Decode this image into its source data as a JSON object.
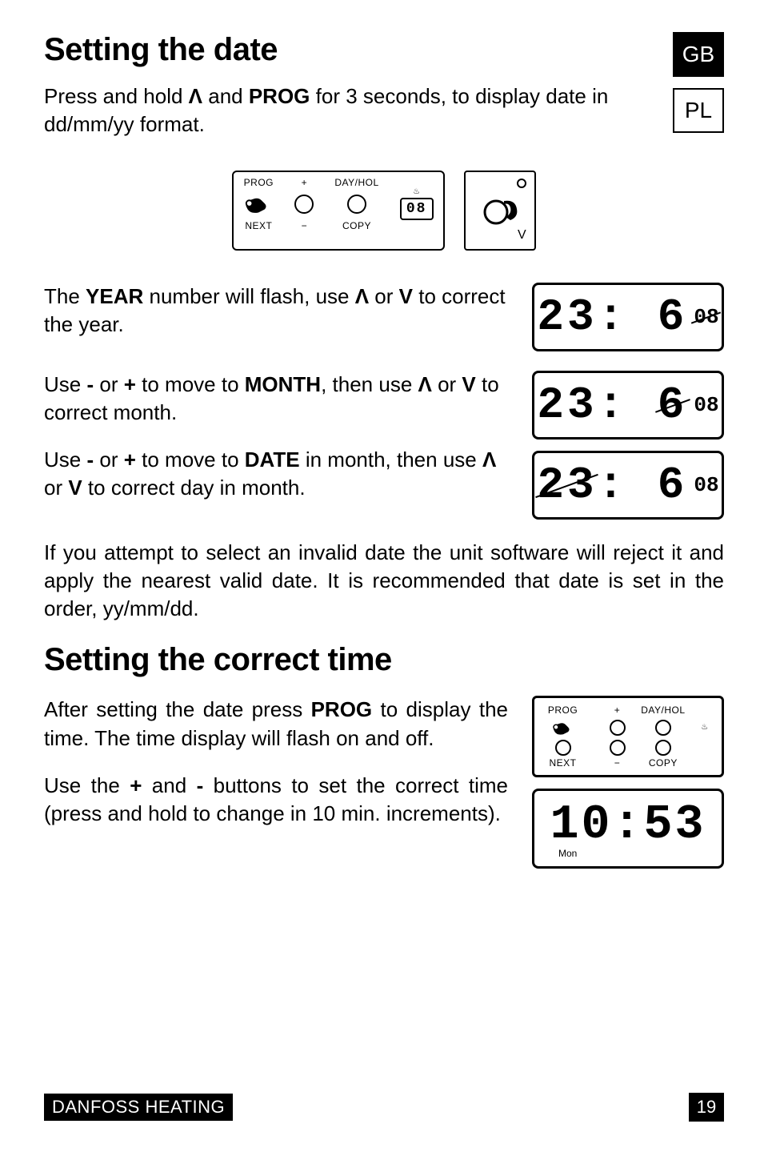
{
  "lang": {
    "gb": "GB",
    "pl": "PL"
  },
  "section1": {
    "title": "Setting the date",
    "intro_pre": "Press and hold ",
    "intro_sym1": "Λ",
    "intro_mid1": " and ",
    "intro_bold1": "PROG",
    "intro_post": " for 3 seconds, to display date in dd/mm/yy format."
  },
  "fig1": {
    "labels": {
      "prog": "PROG",
      "plus": "+",
      "dayhol": "DAY/HOL",
      "next": "NEXT",
      "minus": "−",
      "copy": "COPY"
    },
    "small_digits": "08",
    "flame": "♨",
    "dial_v": "V"
  },
  "step_year": {
    "pre": "The ",
    "b1": "YEAR",
    "mid": " number will flash, use ",
    "s1": "Λ",
    "or": " or ",
    "s2": "V",
    "post": " to correct the year.",
    "lcd_main": "23: 6",
    "lcd_sub": "08"
  },
  "step_month": {
    "pre": "Use ",
    "b_minus": "-",
    "or1": " or ",
    "b_plus": "+",
    "mid1": " to move to ",
    "b_month": "MONTH",
    "mid2": ", then use ",
    "s1": "Λ",
    "or2": " or ",
    "s2": "V",
    "post": " to correct month.",
    "lcd_main": "23: 6",
    "lcd_sub": "08"
  },
  "step_date": {
    "pre": "Use ",
    "b_minus": "-",
    "or1": " or ",
    "b_plus": "+",
    "mid1": " to move to ",
    "b_date": "DATE",
    "mid2": " in month, then use ",
    "s1": "Λ",
    "or2": " or ",
    "s2": "V",
    "post": " to correct day in month.",
    "lcd_main": "23: 6",
    "lcd_sub": "08"
  },
  "note": "If you attempt to select an invalid date the unit software will reject it and apply the nearest valid date. It is recommended that date is set in the order, yy/mm/dd.",
  "section2": {
    "title": "Setting the correct time",
    "p1_pre": "After setting the date press ",
    "p1_b": "PROG",
    "p1_post": " to display the time. The time display will flash on and off.",
    "p2_pre": "Use the ",
    "p2_plus": "+",
    "p2_and": " and ",
    "p2_minus": "-",
    "p2_post": " buttons to set the correct time (press and hold to change in 10 min. increments)."
  },
  "fig2": {
    "labels": {
      "prog": "PROG",
      "plus": "+",
      "dayhol": "DAY/HOL",
      "next": "NEXT",
      "minus": "−",
      "copy": "COPY"
    },
    "flame": "♨",
    "time": "10:53",
    "day": "Mon"
  },
  "footer": {
    "brand": "DANFOSS HEATING",
    "page": "19"
  }
}
